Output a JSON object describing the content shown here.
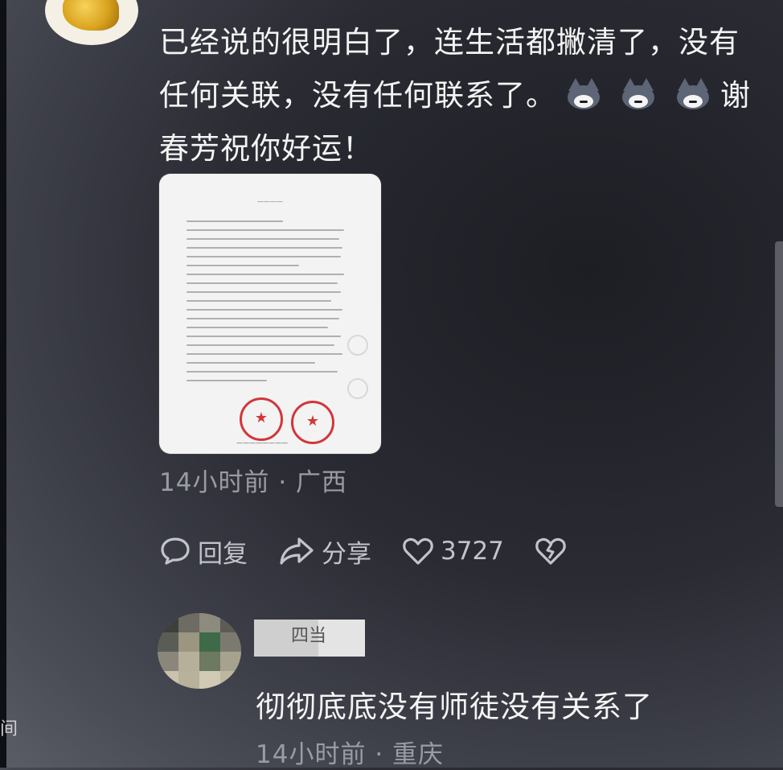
{
  "comment": {
    "text_line1": "已经说的很明白了，连生活都撇清了，没有",
    "text_line2": "任何关联，没有任何联系了。",
    "text_line2_tail": "谢",
    "text_line3": "春芳祝你好运！",
    "emoji_name": "wolf-emoji",
    "time": "14小时前",
    "location": "广西",
    "separator": "·",
    "actions": {
      "reply_label": "回复",
      "share_label": "分享",
      "like_count": "3727"
    }
  },
  "reply": {
    "text": "彻彻底底没有师徒没有关系了",
    "time": "14小时前",
    "location": "重庆",
    "separator": "·",
    "name_fragment": "四当"
  },
  "edge_glyph": "间",
  "colors": {
    "background": "#2a2b33",
    "text": "#f4f4f4",
    "meta": "#9a9ca3",
    "stamp": "#d3353a"
  }
}
